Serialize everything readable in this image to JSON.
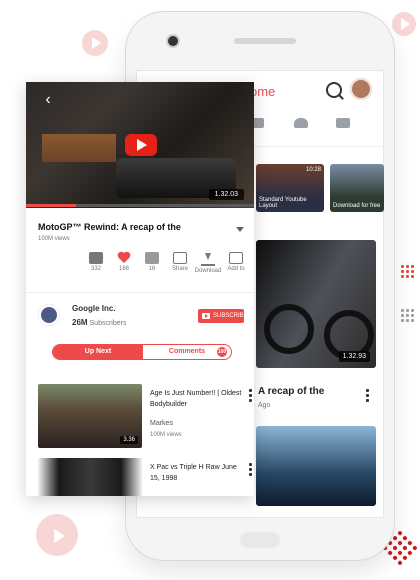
{
  "colors": {
    "accent": "#ef4a4a",
    "text": "#222222",
    "muted": "#777777"
  },
  "background_app": {
    "title": "ome",
    "thumb1_caption": "Standard Youtube Layout",
    "thumb1_duration": "10:28",
    "thumb2_caption": "Download for free",
    "moto_duration": "1.32.93",
    "recap_title": "A recap of the",
    "recap_meta": "Ago",
    "icons": [
      "search-icon",
      "avatar",
      "grid-icon",
      "bell-icon",
      "chart-icon"
    ]
  },
  "video": {
    "duration": "1.32.03",
    "progress": 0.22
  },
  "meta": {
    "title": "MotoGP™ Rewind: A recap of the",
    "views": "100M views"
  },
  "actions": [
    {
      "icon": "thumbs-up-icon",
      "label": "332"
    },
    {
      "icon": "heart-icon",
      "label": "166"
    },
    {
      "icon": "thumbs-down-icon",
      "label": "16"
    },
    {
      "icon": "share-icon",
      "label": "Share"
    },
    {
      "icon": "download-icon",
      "label": "Download"
    },
    {
      "icon": "add-to-icon",
      "label": "Add to"
    }
  ],
  "channel": {
    "name": "Google Inc.",
    "subs_number": "26M",
    "subs_label": "Subscribers",
    "subscribe_label": "SUBSCRIBE"
  },
  "tabs": {
    "up_next": "Up Next",
    "comments": "Comments",
    "comments_badge": "100"
  },
  "list": [
    {
      "title": "Age Is Just Number!! | Oldest Bodybuilder",
      "channel": "Markes",
      "views": "100M views",
      "duration": "3.36"
    },
    {
      "title": "X Pac vs Triple H Raw June 15, 1998"
    }
  ]
}
